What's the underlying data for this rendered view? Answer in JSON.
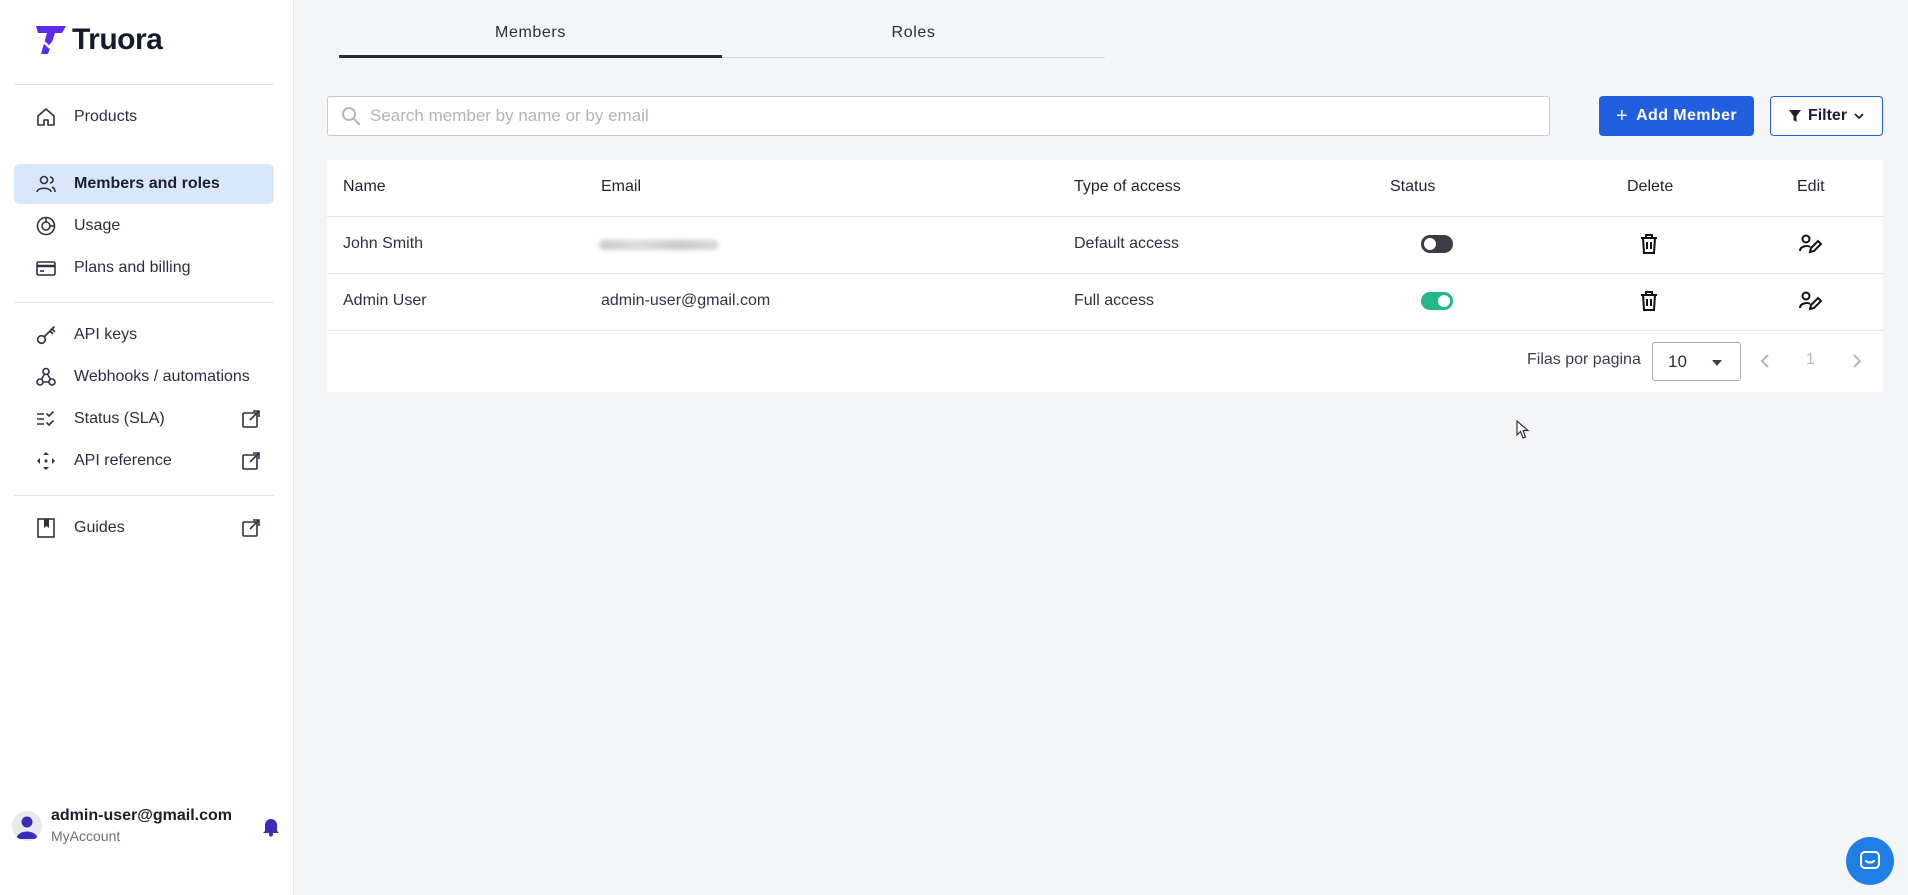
{
  "brand": {
    "name": "Truora",
    "accent": "#1f5fe0",
    "logo_color": "#5b2bf0"
  },
  "sidebar": {
    "items": [
      {
        "label": "Products",
        "icon": "home-icon"
      },
      {
        "label": "Members and roles",
        "icon": "users-icon",
        "active": true
      },
      {
        "label": "Usage",
        "icon": "chart-circle-icon"
      },
      {
        "label": "Plans and billing",
        "icon": "credit-card-icon"
      },
      {
        "label": "API keys",
        "icon": "key-icon"
      },
      {
        "label": "Webhooks / automations",
        "icon": "webhook-icon"
      },
      {
        "label": "Status (SLA)",
        "icon": "checklist-icon",
        "external": true
      },
      {
        "label": "API reference",
        "icon": "move-icon",
        "external": true
      },
      {
        "label": "Guides",
        "icon": "book-icon",
        "external": true
      }
    ],
    "account": {
      "email": "admin-user@gmail.com",
      "subtitle": "MyAccount"
    }
  },
  "tabs": [
    {
      "label": "Members",
      "active": true
    },
    {
      "label": "Roles",
      "active": false
    }
  ],
  "search": {
    "placeholder": "Search member by name or by email",
    "value": ""
  },
  "actions": {
    "add_label": "Add Member",
    "filter_label": "Filter"
  },
  "table": {
    "columns": [
      "Name",
      "Email",
      "Type of access",
      "Status",
      "Delete",
      "Edit"
    ],
    "rows": [
      {
        "name": "John Smith",
        "email": "",
        "access": "Default access",
        "status": false
      },
      {
        "name": "Admin User",
        "email": "admin-user@gmail.com",
        "access": "Full access",
        "status": true
      }
    ]
  },
  "pagination": {
    "label": "Filas por pagina",
    "per_page": "10",
    "page": "1"
  },
  "colors": {
    "toggle_on": "#27b889",
    "toggle_off": "#3a3d46",
    "active_nav_bg": "#d9e7fc"
  }
}
